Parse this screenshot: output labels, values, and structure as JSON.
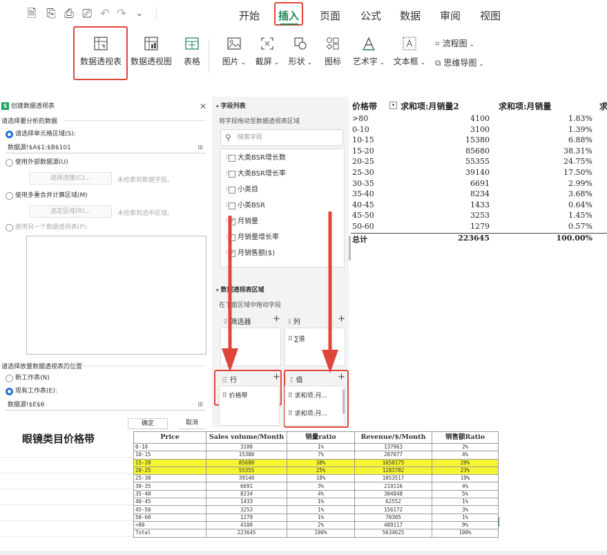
{
  "toolbar": {
    "tabs": [
      "开始",
      "插入",
      "页面",
      "公式",
      "数据",
      "审阅",
      "视图"
    ],
    "active_tab": "插入",
    "accent_color": "#1e8a55",
    "highlight_color": "#e0453a"
  },
  "ribbon": {
    "buttons": [
      "数据透视表",
      "数据透视图",
      "表格",
      "图片",
      "截屏",
      "形状",
      "图标",
      "艺术字",
      "文本框"
    ],
    "flowchart": "流程图",
    "mindmap": "思维导图"
  },
  "dialog": {
    "title": "创建数据透视表",
    "section1": "请选择要分析的数据",
    "opt_range": "请选择单元格区域(S):",
    "range_value": "数据源!$A$1:$B$101",
    "opt_external": "使用外部数据源(U)",
    "btn_connect": "选择连接(C)...",
    "note_connect": "未检索到数据字段。",
    "opt_multi": "使用多重合并计算区域(M)",
    "btn_select_area": "选定区域(R)...",
    "note_area": "未检索到选中区域。",
    "opt_other_pivot": "使用另一个数据透视表(P):",
    "section2": "请选择放置数据透视表的位置",
    "opt_new_sheet": "新工作表(N)",
    "opt_existing_sheet": "现有工作表(E):",
    "existing_value": "数据源!$E$6",
    "ok": "确定",
    "cancel": "取消"
  },
  "fieldpanel": {
    "header": "字段列表",
    "hint": "将字段拖动至数据透视表区域",
    "search_placeholder": "搜索字段",
    "fields": [
      {
        "name": "大类BSR增长数",
        "checked": false
      },
      {
        "name": "大类BSR增长率",
        "checked": false
      },
      {
        "name": "小类目",
        "checked": false
      },
      {
        "name": "小类BSR",
        "checked": false
      },
      {
        "name": "月销量",
        "checked": true
      },
      {
        "name": "月销量增长率",
        "checked": false
      },
      {
        "name": "月销售额($)",
        "checked": true
      }
    ],
    "area_header": "数据透视表区域",
    "area_hint": "在下面区域中拖动字段",
    "filter": "筛选器",
    "column": "列",
    "column_item": "∑值",
    "row": "行",
    "row_item": "价格带",
    "values": "值",
    "value_items": [
      "求和项:月...",
      "求和项:月..."
    ]
  },
  "pivot": {
    "headers": [
      "价格带",
      "求和项:月销量2",
      "求和项:月销量",
      "求"
    ],
    "rows": [
      [
        ">80",
        "4100",
        "1.83%"
      ],
      [
        "0-10",
        "3100",
        "1.39%"
      ],
      [
        "10-15",
        "15380",
        "6.88%"
      ],
      [
        "15-20",
        "85680",
        "38.31%"
      ],
      [
        "20-25",
        "55355",
        "24.75%"
      ],
      [
        "25-30",
        "39140",
        "17.50%"
      ],
      [
        "30-35",
        "6691",
        "2.99%"
      ],
      [
        "35-40",
        "8234",
        "3.68%"
      ],
      [
        "40-45",
        "1433",
        "0.64%"
      ],
      [
        "45-50",
        "3253",
        "1.45%"
      ],
      [
        "50-60",
        "1279",
        "0.57%"
      ]
    ],
    "total": [
      "总计",
      "223645",
      "100.00%"
    ]
  },
  "sheet": {
    "title": "眼镜类目价格带",
    "headers": [
      "Price",
      "Sales volume/Month",
      "销量ratio",
      "Revenue/$/Month",
      "销售额Ratio"
    ],
    "rows": [
      [
        "0-10",
        "3100",
        "1%",
        "137963",
        "2%"
      ],
      [
        "10-15",
        "15380",
        "7%",
        "207077",
        "4%"
      ],
      [
        "15-20",
        "85680",
        "38%",
        "1650175",
        "29%"
      ],
      [
        "20-25",
        "55355",
        "25%",
        "1283782",
        "23%"
      ],
      [
        "25-30",
        "39140",
        "18%",
        "1053517",
        "19%"
      ],
      [
        "30-35",
        "6691",
        "3%",
        "219116",
        "4%"
      ],
      [
        "35-40",
        "8234",
        "4%",
        "304848",
        "5%"
      ],
      [
        "40-45",
        "1433",
        "1%",
        "62552",
        "1%"
      ],
      [
        "45-50",
        "3253",
        "1%",
        "156172",
        "3%"
      ],
      [
        "50-60",
        "1279",
        "1%",
        "70305",
        "1%"
      ],
      [
        ">80",
        "4100",
        "2%",
        "489117",
        "9%"
      ],
      [
        "Total",
        "223645",
        "100%",
        "5634625",
        "100%"
      ]
    ],
    "highlight_rows": [
      "15-20",
      "20-25"
    ],
    "highlight_color": "#f5f531"
  }
}
